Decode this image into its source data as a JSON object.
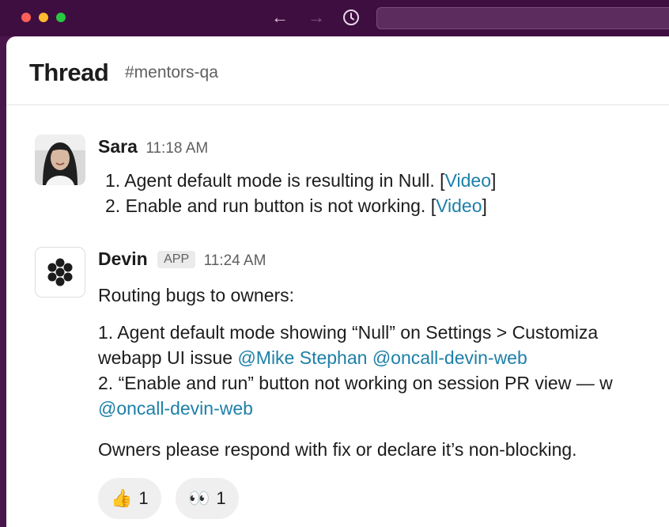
{
  "window": {
    "nav": {
      "back": "←",
      "forward": "→",
      "history": "history"
    }
  },
  "thread": {
    "title": "Thread",
    "channel": "#mentors-qa"
  },
  "messages": [
    {
      "author": "Sara",
      "time": "11:18 AM",
      "items": [
        {
          "prefix": "1. Agent default mode is resulting in Null. [",
          "link": "Video",
          "suffix": "]"
        },
        {
          "prefix": "2. Enable and run button is not working. [",
          "link": "Video",
          "suffix": "]"
        }
      ]
    },
    {
      "author": "Devin",
      "badge": "APP",
      "time": "11:24 AM",
      "intro": "Routing bugs to owners:",
      "body": [
        "1. Agent default mode showing “Null” on Settings > Customiza",
        "webapp UI issue",
        "@Mike Stephan",
        "@oncall-devin-web",
        "2. “Enable and run” button not working on session PR view — w",
        "@oncall-devin-web"
      ],
      "closing": "Owners please respond with fix or declare it’s non-blocking."
    }
  ],
  "reactions": [
    {
      "emoji": "👍",
      "icon": "thumbs-up-icon",
      "count": "1"
    },
    {
      "emoji": "👀",
      "icon": "eyes-icon",
      "count": "1"
    }
  ],
  "colors": {
    "link": "#1d7fa8",
    "sidebar": "#3f0e40"
  }
}
